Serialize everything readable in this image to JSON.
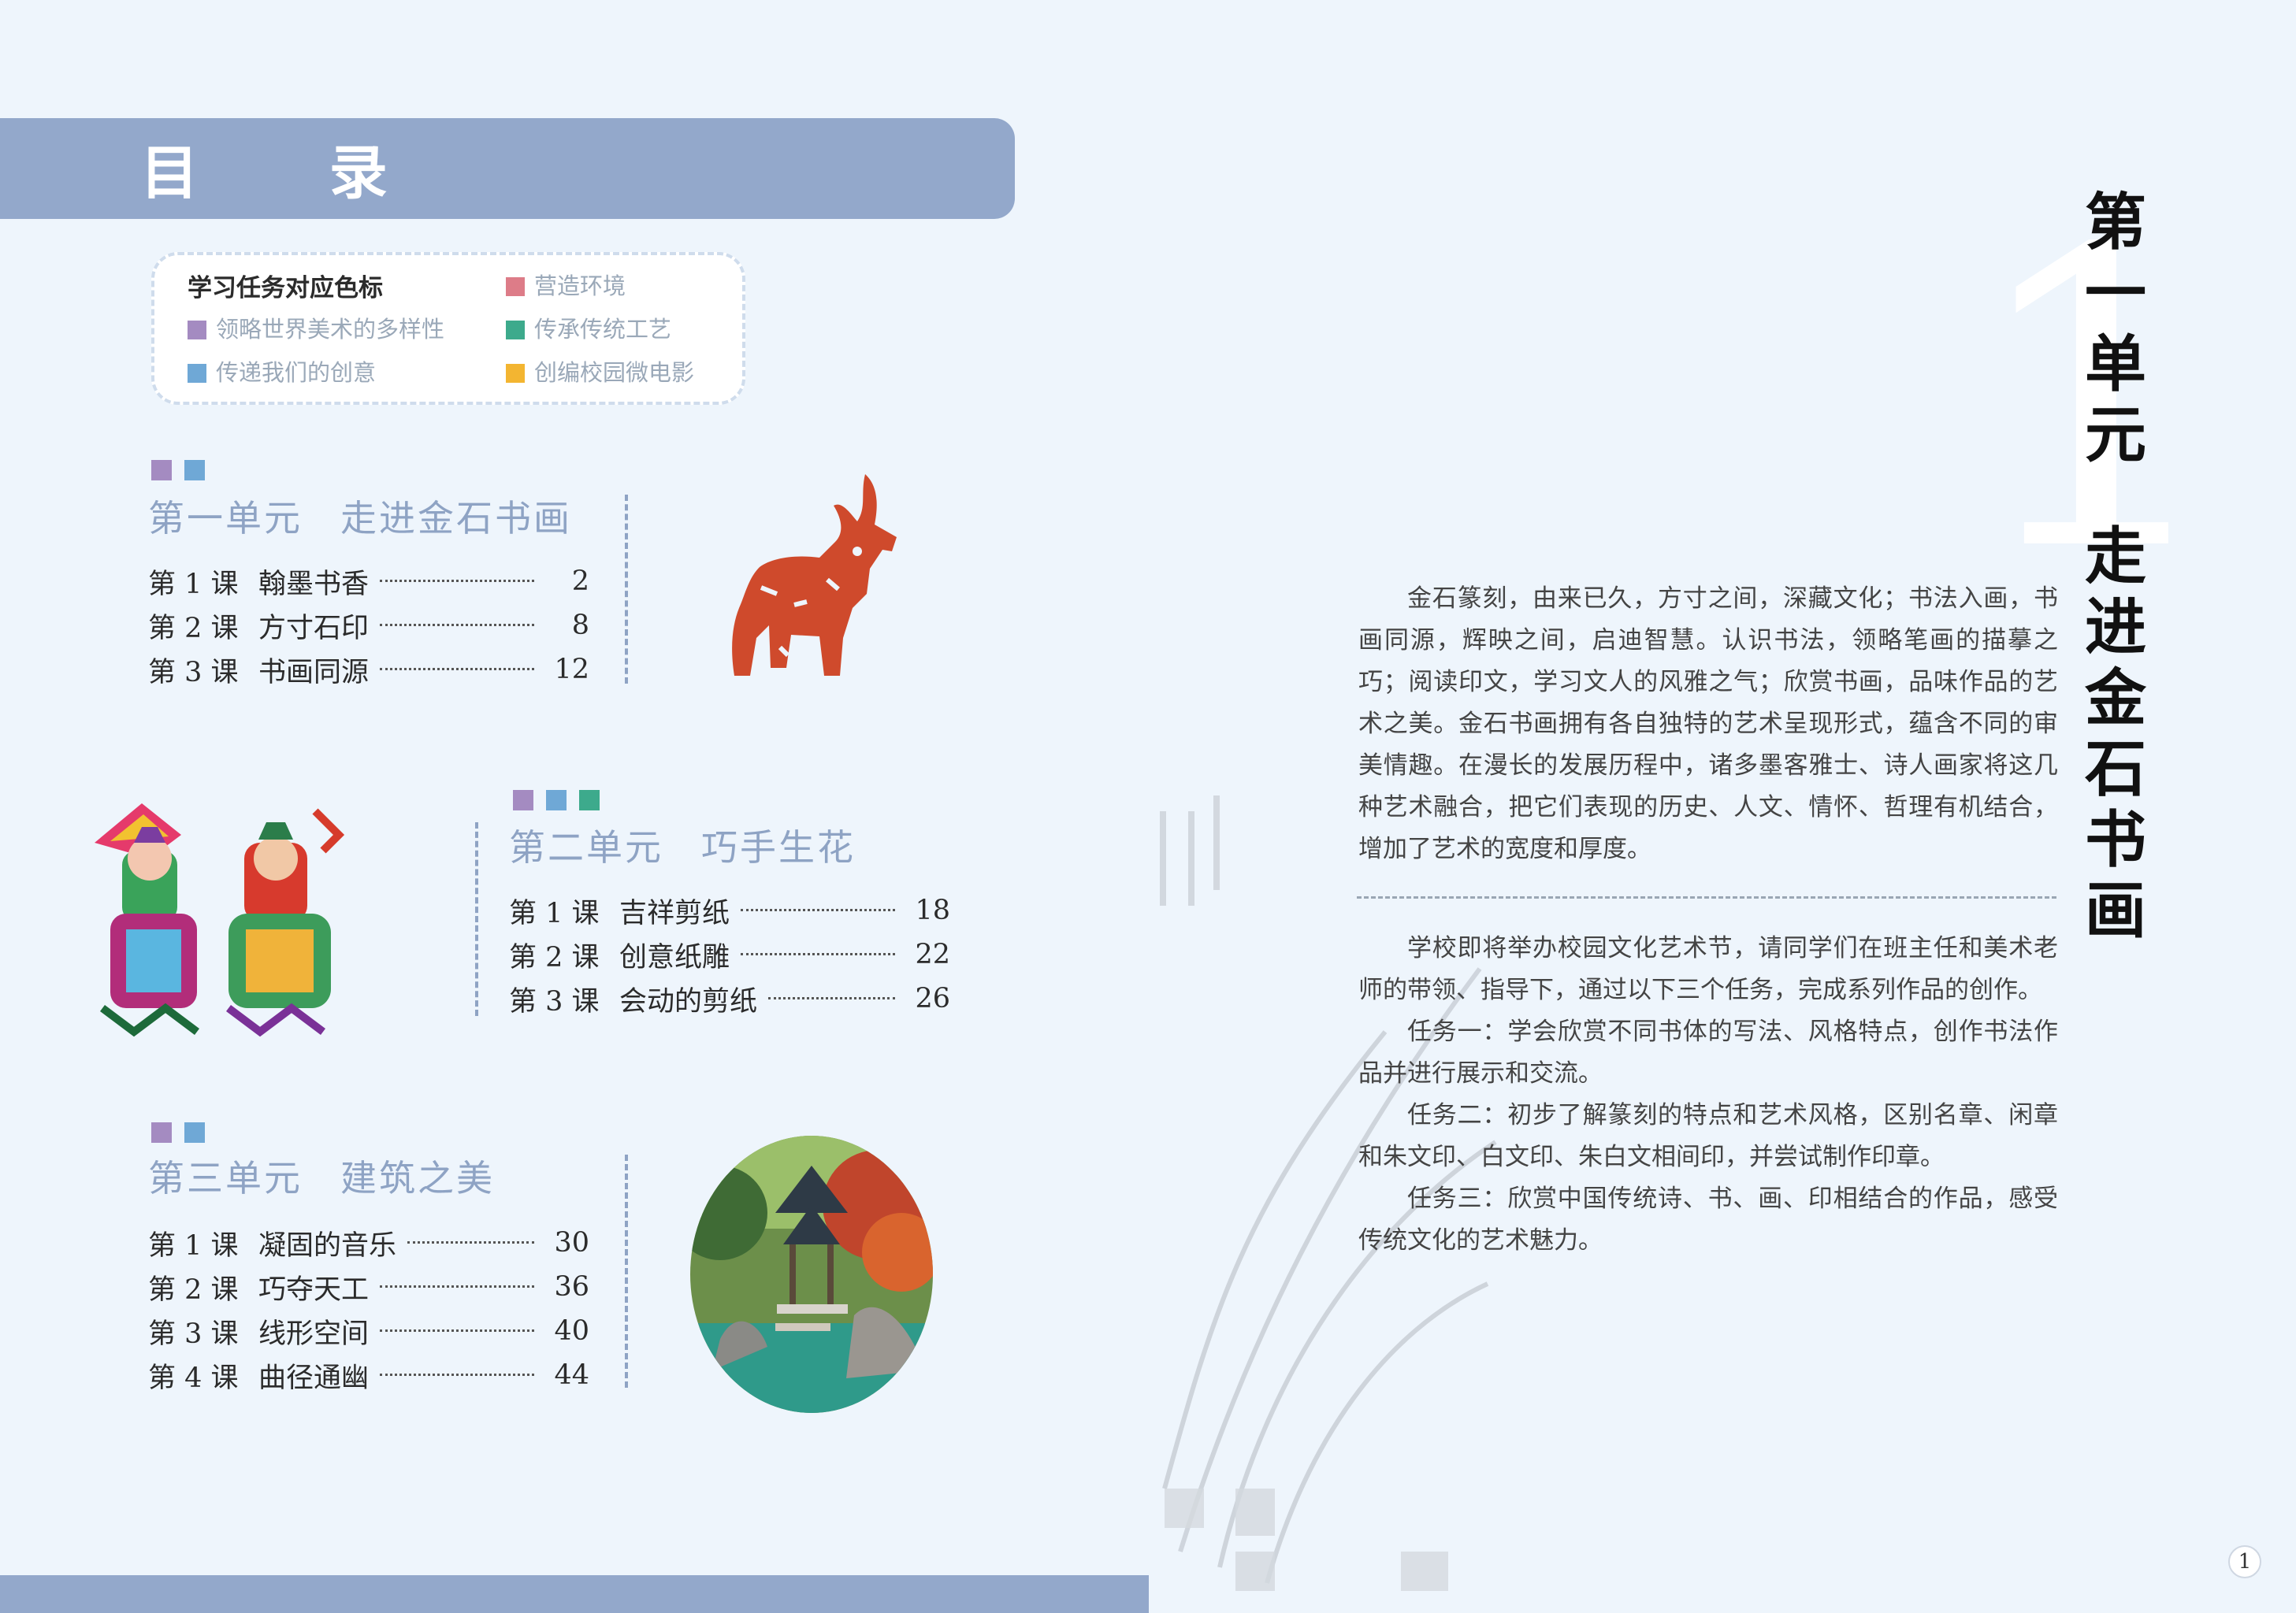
{
  "toc": {
    "title": "目 录"
  },
  "legend": {
    "title": "学习任务对应色标",
    "items": [
      {
        "label": "领略世界美术的多样性",
        "color": "#a48bc1"
      },
      {
        "label": "传递我们的创意",
        "color": "#6fa8d6"
      },
      {
        "label": "营造环境",
        "color": "#dd7c88"
      },
      {
        "label": "传承传统工艺",
        "color": "#3daa8c"
      },
      {
        "label": "创编校园微电影",
        "color": "#f3b531"
      }
    ]
  },
  "units": [
    {
      "unit": "第一单元",
      "name": "走进金石书画",
      "lessons": [
        {
          "num": "第 1 课",
          "title": "翰墨书香",
          "page": "2"
        },
        {
          "num": "第 2 课",
          "title": "方寸石印",
          "page": "8"
        },
        {
          "num": "第 3 课",
          "title": "书画同源",
          "page": "12"
        }
      ]
    },
    {
      "unit": "第二单元",
      "name": "巧手生花",
      "lessons": [
        {
          "num": "第 1 课",
          "title": "吉祥剪纸",
          "page": "18"
        },
        {
          "num": "第 2 课",
          "title": "创意纸雕",
          "page": "22"
        },
        {
          "num": "第 3 课",
          "title": "会动的剪纸",
          "page": "26"
        }
      ]
    },
    {
      "unit": "第三单元",
      "name": "建筑之美",
      "lessons": [
        {
          "num": "第 1 课",
          "title": "凝固的音乐",
          "page": "30"
        },
        {
          "num": "第 2 课",
          "title": "巧夺天工",
          "page": "36"
        },
        {
          "num": "第 3 课",
          "title": "线形空间",
          "page": "40"
        },
        {
          "num": "第 4 课",
          "title": "曲径通幽",
          "page": "44"
        }
      ]
    }
  ],
  "right": {
    "big_number": "1",
    "title_top": [
      "第",
      "一",
      "单",
      "元"
    ],
    "title_bottom": [
      "走",
      "进",
      "金",
      "石",
      "书",
      "画"
    ],
    "intro": "金石篆刻，由来已久，方寸之间，深藏文化；书法入画，书画同源，辉映之间，启迪智慧。认识书法，领略笔画的描摹之巧；阅读印文，学习文人的风雅之气；欣赏书画，品味作品的艺术之美。金石书画拥有各自独特的艺术呈现形式，蕴含不同的审美情趣。在漫长的发展历程中，诸多墨客雅士、诗人画家将这几种艺术融合，把它们表现的历史、人文、情怀、哲理有机结合，增加了艺术的宽度和厚度。",
    "tasks_intro": "学校即将举办校园文化艺术节，请同学们在班主任和美术老师的带领、指导下，通过以下三个任务，完成系列作品的创作。",
    "task1": "任务一：学会欣赏不同书体的写法、风格特点，创作书法作品并进行展示和交流。",
    "task2": "任务二：初步了解篆刻的特点和艺术风格，区别名章、闲章和朱文印、白文印、朱白文相间印，并尝试制作印章。",
    "task3": "任务三：欣赏中国传统诗、书、画、印相结合的作品，感受传统文化的艺术魅力。"
  },
  "page_number": "1"
}
